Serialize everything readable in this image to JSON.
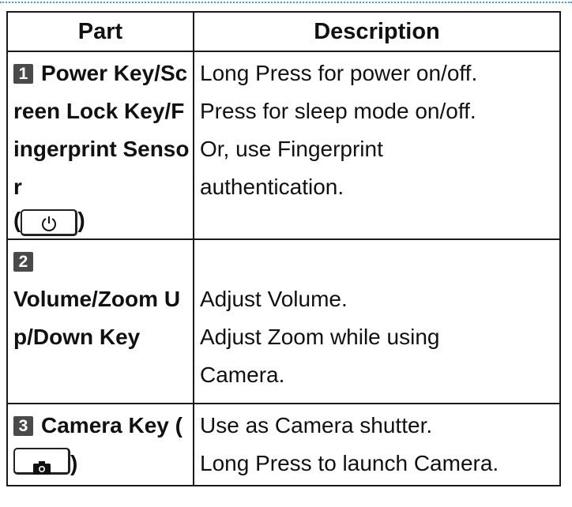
{
  "table": {
    "headers": {
      "part": "Part",
      "description": "Description"
    },
    "rows": [
      {
        "number": "1",
        "part_text": "Power Key/Screen Lock Key/Fingerprint Sensor",
        "part_prefix": "(",
        "part_suffix": ")",
        "key_icon": "power-icon",
        "description": [
          "Long Press for power on/off.",
          "Press for sleep mode on/off.",
          "Or, use Fingerprint",
          "authentication."
        ]
      },
      {
        "number": "2",
        "part_text": "Volume/Zoom Up/Down Key",
        "description": [
          "Adjust Volume.",
          "Adjust Zoom while using",
          "Camera."
        ]
      },
      {
        "number": "3",
        "part_text": "Camera Key",
        "part_prefix": "(",
        "part_suffix": ")",
        "key_icon": "camera-icon",
        "description": [
          "Use as Camera shutter.",
          "Long Press to launch Camera."
        ]
      }
    ]
  }
}
